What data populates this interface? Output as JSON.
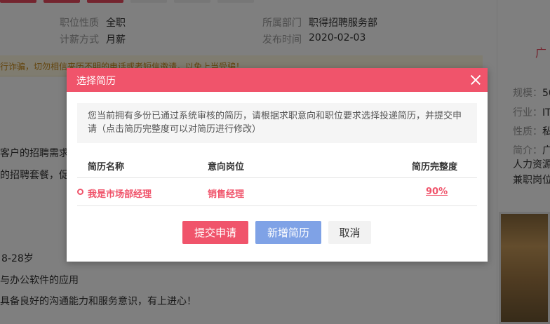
{
  "background": {
    "meta": {
      "job_type_label": "职位性质",
      "job_type_value": "全职",
      "salary_method_label": "计薪方式",
      "salary_method_value": "月薪",
      "dept_label": "所属部门",
      "dept_value": "职得招聘服务部",
      "publish_label": "发布时间",
      "publish_value": "2020-02-03"
    },
    "warning_text": "行诈骗，切勿相信来历不明的电话或者短信邀请，以免上当受骗！",
    "body_lines": [
      "客户的招聘需求",
      "的招聘套餐，促成",
      "8-28岁",
      "与办公软件的应用",
      "具备良好的沟通能力和服务意识，有上进心！"
    ],
    "right_panel": {
      "title": "广",
      "scale_label": "规模：",
      "scale_value": "50",
      "industry_label": "行业：",
      "industry_value": "IT",
      "nature_label": "性质：",
      "nature_value": "私",
      "intro_label": "简介：",
      "intro_value": "广",
      "intro_line2": "人力资源",
      "intro_line3": "兼职岗位"
    }
  },
  "modal": {
    "title": "选择简历",
    "notice": "您当前拥有多份已通过系统审核的简历，请根据求职意向和职位要求选择投递简历，并提交申请（点击简历完整度可以对简历进行修改）",
    "columns": [
      "简历名称",
      "意向岗位",
      "简历完整度"
    ],
    "rows": [
      {
        "name": "我是市场部经理",
        "position": "销售经理",
        "completeness": "90%"
      }
    ],
    "buttons": {
      "submit": "提交申请",
      "new_resume": "新增简历",
      "cancel": "取消"
    }
  },
  "colors": {
    "brand_red": "#f0546b",
    "button_blue": "#7fa2e6"
  }
}
